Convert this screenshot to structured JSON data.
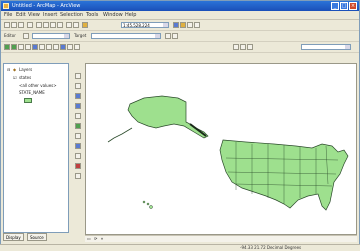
{
  "window": {
    "title": "Untitled - ArcMap - ArcView"
  },
  "menus": [
    "File",
    "Edit",
    "View",
    "Insert",
    "Selection",
    "Tools",
    "Window",
    "Help"
  ],
  "toolbar": {
    "scale_value": "1:45,528,224",
    "editor_label": "Editor",
    "target_label": "Target"
  },
  "toc": {
    "root_label": "Layers",
    "layer_label": "states",
    "legend_label": "<all other values>",
    "sublabel": "STATE_NAME"
  },
  "tabs": [
    "Display",
    "Source"
  ],
  "status": {
    "coordinates": "-94.33  21.72 Decimal Degrees"
  },
  "colors": {
    "land": "#9ee08e",
    "outline": "#2a4a2a",
    "titlebar": "#1f5fcc"
  },
  "icons": [
    "app-icon",
    "zoom-in-icon",
    "zoom-out-icon",
    "pan-icon",
    "full-extent-icon",
    "identify-icon",
    "select-icon",
    "measure-icon"
  ]
}
